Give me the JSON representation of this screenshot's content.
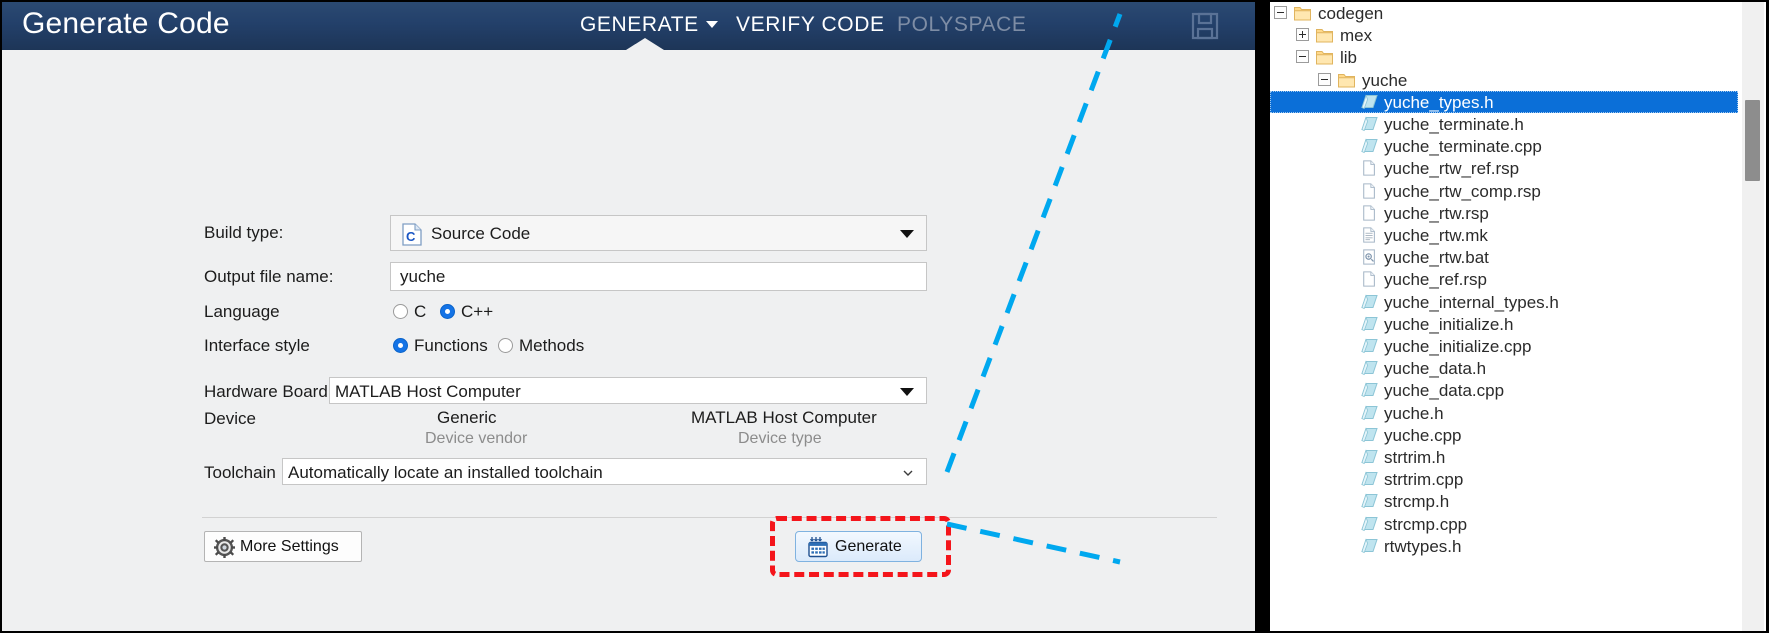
{
  "toolstrip": {
    "title": "Generate Code",
    "tabs": [
      {
        "label": "GENERATE",
        "active": true,
        "has_dropdown": true
      },
      {
        "label": "VERIFY CODE",
        "active": false,
        "has_dropdown": false
      },
      {
        "label": "POLYSPACE",
        "active": false,
        "disabled": true,
        "has_dropdown": false
      }
    ],
    "save_icon": "save-disk-icon",
    "colors": {
      "bar_top": "#2b4a72",
      "bar_bottom": "#1d3557",
      "text": "#ffffff",
      "disabled_text": "#7e8da5"
    }
  },
  "form": {
    "build_type": {
      "label": "Build type:",
      "value": "Source Code",
      "icon": "c-source-file-icon"
    },
    "output_file": {
      "label": "Output file name:",
      "value": "yuche",
      "placeholder": ""
    },
    "language": {
      "label": "Language",
      "options": [
        {
          "label": "C",
          "selected": false
        },
        {
          "label": "C++",
          "selected": true
        }
      ]
    },
    "interface_style": {
      "label": "Interface style",
      "options": [
        {
          "label": "Functions",
          "selected": true
        },
        {
          "label": "Methods",
          "selected": false
        }
      ]
    },
    "hardware_board": {
      "label": "Hardware Board",
      "value": "MATLAB Host Computer"
    },
    "device": {
      "label": "Device",
      "vendor_value": "Generic",
      "vendor_caption": "Device vendor",
      "type_value": "MATLAB Host Computer",
      "type_caption": "Device type"
    },
    "toolchain": {
      "label": "Toolchain",
      "value": "Automatically locate an installed toolchain"
    },
    "more_settings": {
      "label": "More Settings",
      "icon": "gear-icon"
    },
    "generate": {
      "label": "Generate",
      "icon": "generate-grid-icon"
    }
  },
  "annotation": {
    "highlight_color": "#f4151b",
    "callout_color": "#00a8ef",
    "highlight_target": "Generate"
  },
  "tree": {
    "selected": "yuche_types.h",
    "nodes": [
      {
        "label": "codegen",
        "type": "folder",
        "depth": 0,
        "expander": "minus"
      },
      {
        "label": "mex",
        "type": "folder",
        "depth": 1,
        "expander": "plus"
      },
      {
        "label": "lib",
        "type": "folder",
        "depth": 1,
        "expander": "minus"
      },
      {
        "label": "yuche",
        "type": "folder",
        "depth": 2,
        "expander": "minus"
      },
      {
        "label": "yuche_types.h",
        "type": "header",
        "depth": 3,
        "selected": true
      },
      {
        "label": "yuche_terminate.h",
        "type": "header",
        "depth": 3
      },
      {
        "label": "yuche_terminate.cpp",
        "type": "header",
        "depth": 3
      },
      {
        "label": "yuche_rtw_ref.rsp",
        "type": "plaindoc",
        "depth": 3
      },
      {
        "label": "yuche_rtw_comp.rsp",
        "type": "plaindoc",
        "depth": 3
      },
      {
        "label": "yuche_rtw.rsp",
        "type": "plaindoc",
        "depth": 3
      },
      {
        "label": "yuche_rtw.mk",
        "type": "lineddoc",
        "depth": 3
      },
      {
        "label": "yuche_rtw.bat",
        "type": "batdoc",
        "depth": 3
      },
      {
        "label": "yuche_ref.rsp",
        "type": "plaindoc",
        "depth": 3
      },
      {
        "label": "yuche_internal_types.h",
        "type": "header",
        "depth": 3
      },
      {
        "label": "yuche_initialize.h",
        "type": "header",
        "depth": 3
      },
      {
        "label": "yuche_initialize.cpp",
        "type": "header",
        "depth": 3
      },
      {
        "label": "yuche_data.h",
        "type": "header",
        "depth": 3
      },
      {
        "label": "yuche_data.cpp",
        "type": "header",
        "depth": 3
      },
      {
        "label": "yuche.h",
        "type": "header",
        "depth": 3
      },
      {
        "label": "yuche.cpp",
        "type": "header",
        "depth": 3
      },
      {
        "label": "strtrim.h",
        "type": "header",
        "depth": 3
      },
      {
        "label": "strtrim.cpp",
        "type": "header",
        "depth": 3
      },
      {
        "label": "strcmp.h",
        "type": "header",
        "depth": 3
      },
      {
        "label": "strcmp.cpp",
        "type": "header",
        "depth": 3
      },
      {
        "label": "rtwtypes.h",
        "type": "header",
        "depth": 3
      }
    ]
  }
}
